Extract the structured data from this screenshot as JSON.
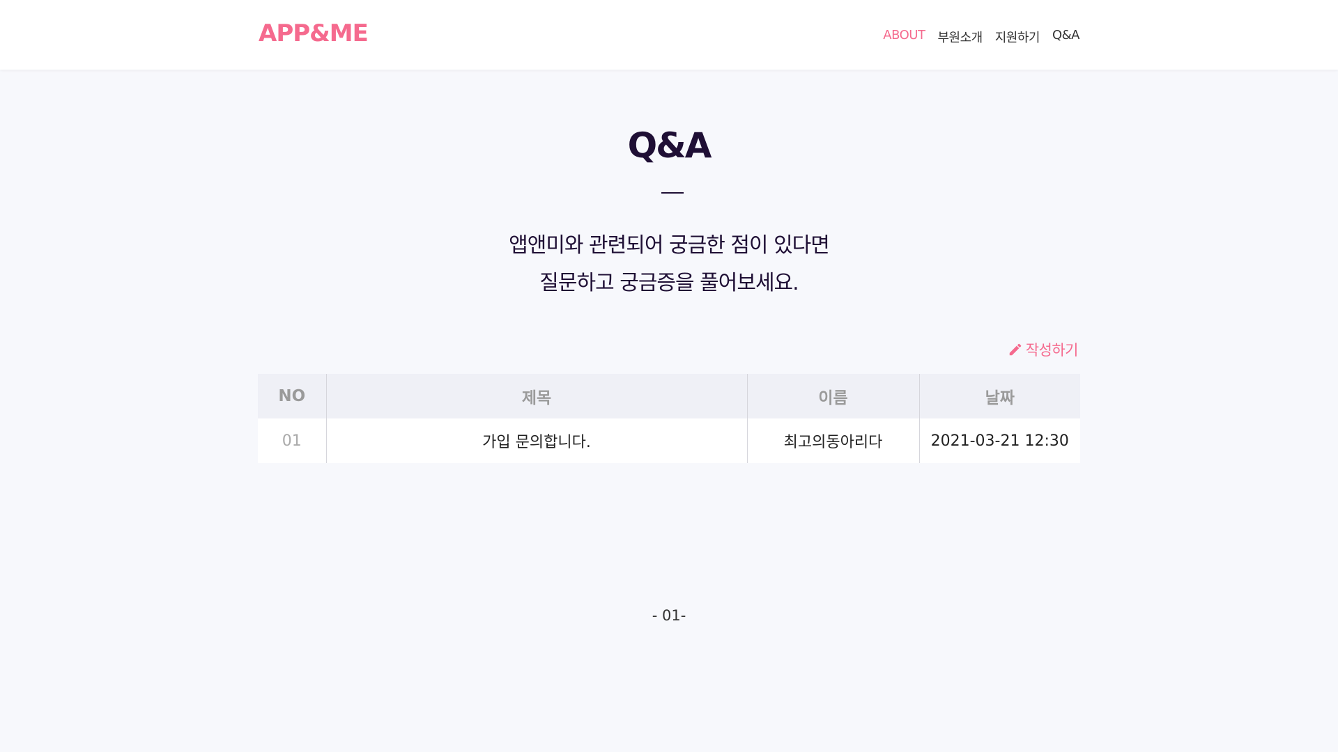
{
  "header": {
    "logo": "APP&ME",
    "nav": [
      "ABOUT",
      "부원소개",
      "지원하기",
      "Q&A"
    ],
    "accent_color": "#f56a8e"
  },
  "main": {
    "title": "Q&A",
    "subtitle_lines": [
      "앱앤미와 관련되어 궁금한 점이 있다면",
      "질문하고 궁금증을 풀어보세요."
    ],
    "write_button": {
      "label": "작성하기",
      "icon": "pencil-icon"
    }
  },
  "board": {
    "columns": [
      "NO",
      "제목",
      "이름",
      "날짜"
    ],
    "rows": [
      {
        "no": "01",
        "title": "가입 문의합니다.",
        "name": "최고의동아리다",
        "date": "2021-03-21 12:30"
      }
    ]
  },
  "pager": {
    "text": "- 01-"
  }
}
